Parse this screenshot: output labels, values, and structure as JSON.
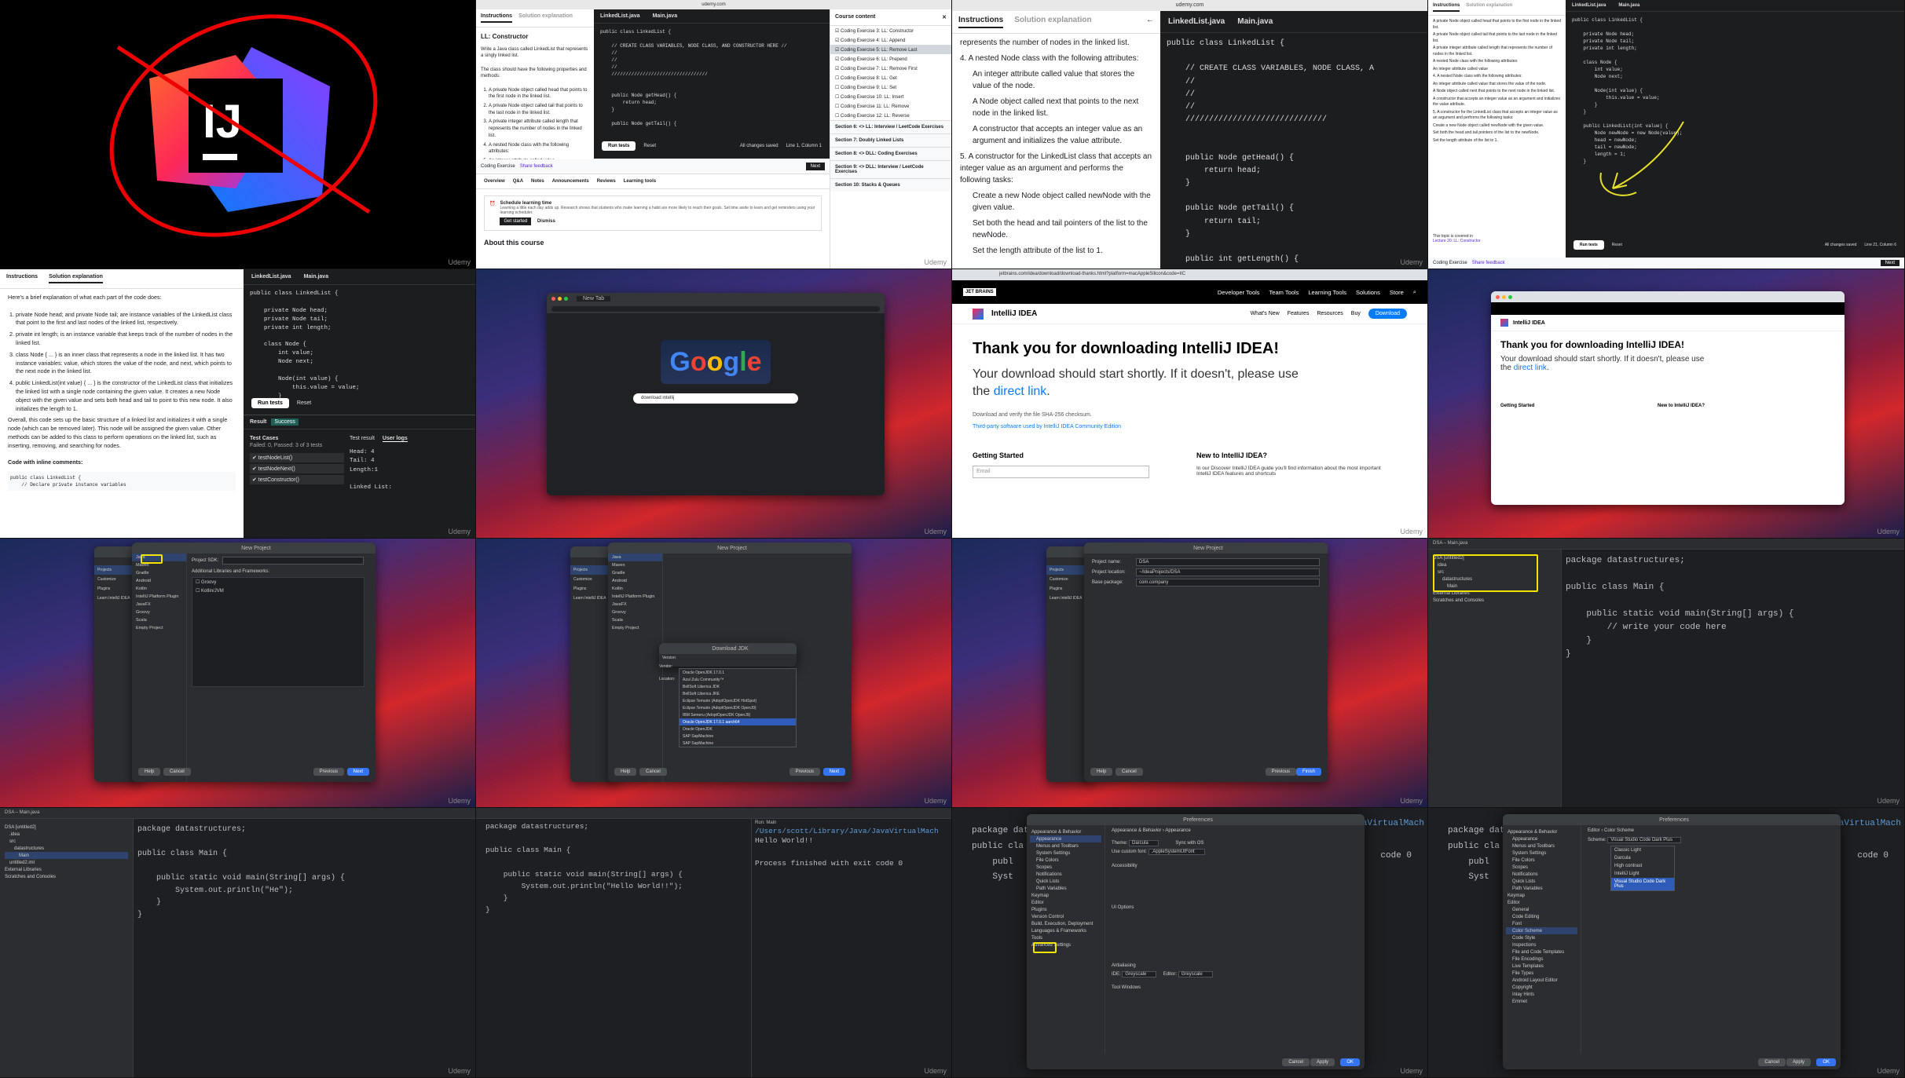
{
  "watermark": "Udemy",
  "cell1": {
    "logo_text": "IJ"
  },
  "cell2": {
    "tabs": [
      "Instructions",
      "Solution explanation"
    ],
    "title": "LL: Constructor",
    "intro": "Write a Java class called LinkedList that represents a singly linked list.",
    "props_intro": "The class should have the following properties and methods:",
    "bullets": [
      "A private Node object called head that points to the first node in the linked list.",
      "A private Node object called tail that points to the last node in the linked list.",
      "A private integer attribute called length that represents the number of nodes in the linked list.",
      "A nested Node class with the following attributes:",
      "An integer attribute called value"
    ],
    "editor_tabs": [
      "LinkedList.java",
      "Main.java"
    ],
    "code": [
      "public class LinkedList {",
      "",
      "    // CREATE CLASS VARIABLES, NODE CLASS, AND CONSTRUCTOR HERE //",
      "    //",
      "    //",
      "    //",
      "    //////////////////////////////////",
      "",
      "",
      "    public Node getHead() {",
      "        return head;",
      "    }",
      "",
      "    public Node getTail() {"
    ],
    "run_label": "Run tests",
    "reset_label": "Reset",
    "saved_label": "All changes saved",
    "pos_label": "Line 1, Column 1",
    "course_content": "Course content",
    "course_items": [
      "Coding Exercise 3: LL: Constructor",
      "Coding Exercise 4: LL: Append",
      "Coding Exercise 5: LL: Remove Last",
      "Coding Exercise 6: LL: Prepend",
      "Coding Exercise 7: LL: Remove First",
      "Coding Exercise 8: LL: Get",
      "Coding Exercise 9: LL: Set",
      "Coding Exercise 10: LL: Insert",
      "Coding Exercise 11: LL: Remove",
      "Coding Exercise 12: LL: Reverse"
    ],
    "sections": [
      "Section 6: <> LL: Interview / LeetCode Exercises",
      "Section 7: Doubly Linked Lists",
      "Section 8: <> DLL: Coding Exercises",
      "Section 9: <> DLL: Interview / LeetCode Exercises",
      "Section 10: Stacks & Queues"
    ],
    "bottom_tabs": [
      "Overview",
      "Q&A",
      "Notes",
      "Announcements",
      "Reviews",
      "Learning tools"
    ],
    "schedule_title": "Schedule learning time",
    "schedule_text": "Learning a little each day adds up. Research shows that students who make learning a habit are more likely to reach their goals. Set time aside to learn and get reminders using your learning scheduler.",
    "get_started": "Get started",
    "dismiss": "Dismiss",
    "about": "About this course",
    "coding_exercise": "Coding Exercise",
    "share_feedback": "Share feedback",
    "next": "Next"
  },
  "cell3": {
    "tabs": [
      "Instructions",
      "Solution explanation"
    ],
    "lines": [
      "represents the number of nodes in the linked list.",
      "4. A nested Node class with the following attributes:",
      "An integer attribute called value that stores the value of the node.",
      "A Node object called next that points to the next node in the linked list.",
      "A constructor that accepts an integer value as an argument and initializes the value attribute.",
      "5. A constructor for the LinkedList class that accepts an integer value as an argument and performs the following tasks:",
      "Create a new Node object called newNode with the given value.",
      "Set both the head and tail pointers of the list to the newNode.",
      "Set the length attribute of the list to 1."
    ],
    "editor_tabs": [
      "LinkedList.java",
      "Main.java"
    ],
    "code": [
      "public class LinkedList {",
      "",
      "    // CREATE CLASS VARIABLES, NODE CLASS, A",
      "    //",
      "    //",
      "    //",
      "    //////////////////////////////",
      "",
      "",
      "    public Node getHead() {",
      "        return head;",
      "    }",
      "",
      "    public Node getTail() {",
      "        return tail;",
      "    }",
      "",
      "    public int getLength() {"
    ],
    "url": "udemy.com"
  },
  "cell4": {
    "tabs": [
      "Instructions",
      "Solution explanation"
    ],
    "code": [
      "public class LinkedList {",
      "",
      "    private Node head;",
      "    private Node tail;",
      "    private int length;",
      "",
      "    class Node {",
      "        int value;",
      "        Node next;",
      "",
      "        Node(int value) {",
      "            this.value = value;",
      "        }",
      "    }",
      "",
      "    public LinkedList(int value) {",
      "        Node newNode = new Node(value);",
      "        head = newNode;",
      "        tail = newNode;",
      "        length = 1;",
      "    }"
    ],
    "topic": "This topic is covered in",
    "lecture": "Lecture 20: LL: Constructor",
    "run_label": "Run tests",
    "reset_label": "Reset",
    "saved_label": "All changes saved",
    "pos_label": "Line 21, Column 6"
  },
  "cell5": {
    "tabs": [
      "Instructions",
      "Solution explanation"
    ],
    "intro": "Here's a brief explanation of what each part of the code does:",
    "paras": [
      "private Node head; and private Node tail; are instance variables of the LinkedList class that point to the first and last nodes of the linked list, respectively.",
      "private int length; is an instance variable that keeps track of the number of nodes in the linked list.",
      "class Node { ... } is an inner class that represents a node in the linked list. It has two instance variables: value, which stores the value of the node, and next, which points to the next node in the linked list.",
      "public LinkedList(int value) { ... } is the constructor of the LinkedList class that initializes the linked list with a single node containing the given value. It creates a new Node object with the given value and sets both head and tail to point to this new node. It also initializes the length to 1."
    ],
    "overall": "Overall, this code sets up the basic structure of a linked list and initializes it with a single node (which can be removed later). This node will be assigned the given value. Other methods can be added to this class to perform operations on the linked list, such as inserting, removing, and searching for nodes.",
    "inline_title": "Code with inline comments:",
    "inline_code": [
      "public class LinkedList {",
      "    // Declare private instance variables"
    ],
    "editor_tabs": [
      "LinkedList.java",
      "Main.java"
    ],
    "code": [
      "public class LinkedList {",
      "",
      "    private Node head;",
      "    private Node tail;",
      "    private int length;",
      "",
      "    class Node {",
      "        int value;",
      "        Node next;",
      "",
      "        Node(int value) {",
      "            this.value = value;",
      "        }"
    ],
    "run_label": "Run tests",
    "reset_label": "Reset",
    "result": "Result",
    "success": "Success",
    "test_cases": "Test Cases",
    "test_summary": "Failed: 0, Passed: 3 of 3 tests",
    "tests": [
      "testNodeList()",
      "testNodeNext()",
      "testConstructor()"
    ],
    "test_result": "Test result",
    "user_logs": "User logs",
    "output": [
      "Head: 4",
      "Tail: 4",
      "Length:1",
      "",
      "Linked List:"
    ]
  },
  "cell6": {
    "search_text": "download intellij",
    "tab_label": "New Tab"
  },
  "cell7": {
    "url": "jetbrains.com/idea/download/download-thanks.html?platform=macAppleSilicon&code=IIC",
    "brand": "IntelliJ IDEA",
    "logo": "JET BRAINS",
    "nav": [
      "Developer Tools",
      "Team Tools",
      "Learning Tools",
      "Solutions",
      "Store"
    ],
    "subnav": [
      "What's New",
      "Features",
      "Resources",
      "Buy"
    ],
    "download_btn": "Download",
    "headline": "Thank you for downloading IntelliJ IDEA!",
    "sub": "Your download should start shortly. If it doesn't, please use the",
    "link": "direct link",
    "checksum": "Download and verify the file SHA-256 checksum.",
    "third_party": "Third-party software used by IntelliJ IDEA Community Edition",
    "getting_started": "Getting Started",
    "new_to": "New to IntelliJ IDEA?",
    "email_placeholder": "Email",
    "discover": "In our Discover IntelliJ IDEA guide you'll find information about the most important IntelliJ IDEA features and shortcuts"
  },
  "cell8": {
    "headline": "Thank you for downloading IntelliJ IDEA!",
    "sub": "Your download should start shortly. If it doesn't, please use the",
    "link": "direct link",
    "brand": "IntelliJ IDEA",
    "getting_started": "Getting Started",
    "new_to": "New to IntelliJ IDEA?"
  },
  "cell9": {
    "title": "New Project",
    "side": [
      "Java",
      "Maven",
      "Gradle",
      "Android",
      "Kotlin",
      "IntelliJ Platform Plugin",
      "JavaFX",
      "Groovy",
      "Scala",
      "Empty Project"
    ],
    "welcome": [
      "Projects",
      "Customize",
      "Plugins",
      "Learn IntelliJ IDEA"
    ],
    "project_sdk": "Project SDK:",
    "libs": "Additional Libraries and Frameworks:",
    "lib_items": [
      "Groovy",
      "Kotlin/JVM"
    ],
    "buttons": [
      "Help",
      "Cancel",
      "Previous",
      "Next"
    ]
  },
  "cell10": {
    "dialog_title": "Download JDK",
    "version_label": "Version:",
    "vendor_label": "Vendor:",
    "location_label": "Location:",
    "vendors": [
      "Oracle OpenJDK 17.0.1",
      "Azul Zulu Community™",
      "BellSoft Liberica JDK",
      "BellSoft Liberica JRE",
      "Eclipse Temurin (AdoptOpenJDK HotSpot)",
      "Eclipse Temurin (AdoptOpenJDK OpenJ9)",
      "IBM Semeru (AdoptOpenJDK OpenJ9)",
      "Oracle OpenJDK 17.0.1 aarch64",
      "Oracle OpenJDK",
      "SAP SapMachine",
      "SAP SapMachine"
    ],
    "selected_index": 7,
    "buttons": [
      "Help",
      "Cancel",
      "Previous",
      "Next"
    ]
  },
  "cell11": {
    "title": "New Project",
    "fields": [
      {
        "label": "Project name:",
        "value": "DSA"
      },
      {
        "label": "Project location:",
        "value": "~/IdeaProjects/DSA"
      },
      {
        "label": "Base package:",
        "value": "com.company"
      }
    ],
    "buttons": [
      "Help",
      "Cancel",
      "Previous",
      "Finish"
    ]
  },
  "cell12": {
    "title": "DSA – Main.java",
    "tree": [
      "DSA [untitled2]",
      "idea",
      "src",
      "datastructures",
      "Main",
      "External Libraries",
      "Scratches and Consoles"
    ],
    "code": [
      "package datastructures;",
      "",
      "public class Main {",
      "",
      "    public static void main(String[] args) {",
      "        // write your code here",
      "    }",
      "}"
    ]
  },
  "cell13": {
    "title": "DSA – Main.java",
    "tree": [
      "DSA [untitled2]",
      ".idea",
      "src",
      "datastructures",
      "Main",
      "untitled2.iml",
      "External Libraries",
      "Scratches and Consoles"
    ],
    "code": [
      "package datastructures;",
      "",
      "public class Main {",
      "",
      "    public static void main(String[] args) {",
      "        System.out.println(\"He\");",
      "    }",
      "}"
    ]
  },
  "cell14": {
    "code": [
      "package datastructures;",
      "",
      "public class Main {",
      "",
      "    public static void main(String[] args) {",
      "        System.out.println(\"Hello World!!\");",
      "    }",
      "}"
    ],
    "run_path": "/Users/scott/Library/Java/JavaVirtualMach",
    "run_output": [
      "Hello World!!",
      "",
      "Process finished with exit code 0"
    ],
    "run_tab": "Run:",
    "run_name": "Main"
  },
  "cell15": {
    "title": "Preferences",
    "crumb": "Appearance & Behavior › Appearance",
    "tree": [
      "Appearance & Behavior",
      "Appearance",
      "Menus and Toolbars",
      "System Settings",
      "File Colors",
      "Scopes",
      "Notifications",
      "Quick Lists",
      "Path Variables",
      "Keymap",
      "Editor",
      "Plugins",
      "Version Control",
      "Build, Execution, Deployment",
      "Languages & Frameworks",
      "Tools",
      "Advanced Settings"
    ],
    "theme_label": "Theme:",
    "theme_value": "Darcula",
    "sync_label": "Sync with OS",
    "custom_font": "Use custom font:",
    "font_value": ".AppleSystemUIFont",
    "accessibility": "Accessibility",
    "ui_options": "UI Options",
    "antialiasing": "Antialiasing",
    "ide_aa": "Greyscale",
    "editor_aa": "Greyscale",
    "tool_windows": "Tool Windows",
    "buttons": [
      "Cancel",
      "Apply",
      "OK"
    ],
    "behind_code": [
      "package data",
      "public cla",
      "    publ",
      "    Syst"
    ],
    "behind_path": "JavaVirtualMach",
    "behind_exit": "code 0"
  },
  "cell16": {
    "title": "Preferences",
    "crumb": "Editor › Color Scheme",
    "scheme_label": "Scheme:",
    "scheme_value": "Visual Studio Code Dark Plus",
    "scheme_options": [
      "Classic Light",
      "Darcula",
      "High contrast",
      "IntelliJ Light",
      "Visual Studio Code Dark Plus"
    ],
    "selected_option": "Visual Studio Code Dark Plus",
    "tree": [
      "Appearance & Behavior",
      "Appearance",
      "Menus and Toolbars",
      "System Settings",
      "File Colors",
      "Scopes",
      "Notifications",
      "Quick Lists",
      "Path Variables",
      "Keymap",
      "Editor",
      "General",
      "Code Editing",
      "Font",
      "Color Scheme",
      "Code Style",
      "Inspections",
      "File and Code Templates",
      "File Encodings",
      "Live Templates",
      "File Types",
      "Android Layout Editor",
      "Copyright",
      "Inlay Hints",
      "Emmet"
    ],
    "buttons": [
      "Cancel",
      "Apply",
      "OK"
    ],
    "behind_code": [
      "package data",
      "public cla",
      "    publ",
      "    Syst"
    ],
    "behind_path": "JavaVirtualMach",
    "behind_exit": "code 0"
  }
}
